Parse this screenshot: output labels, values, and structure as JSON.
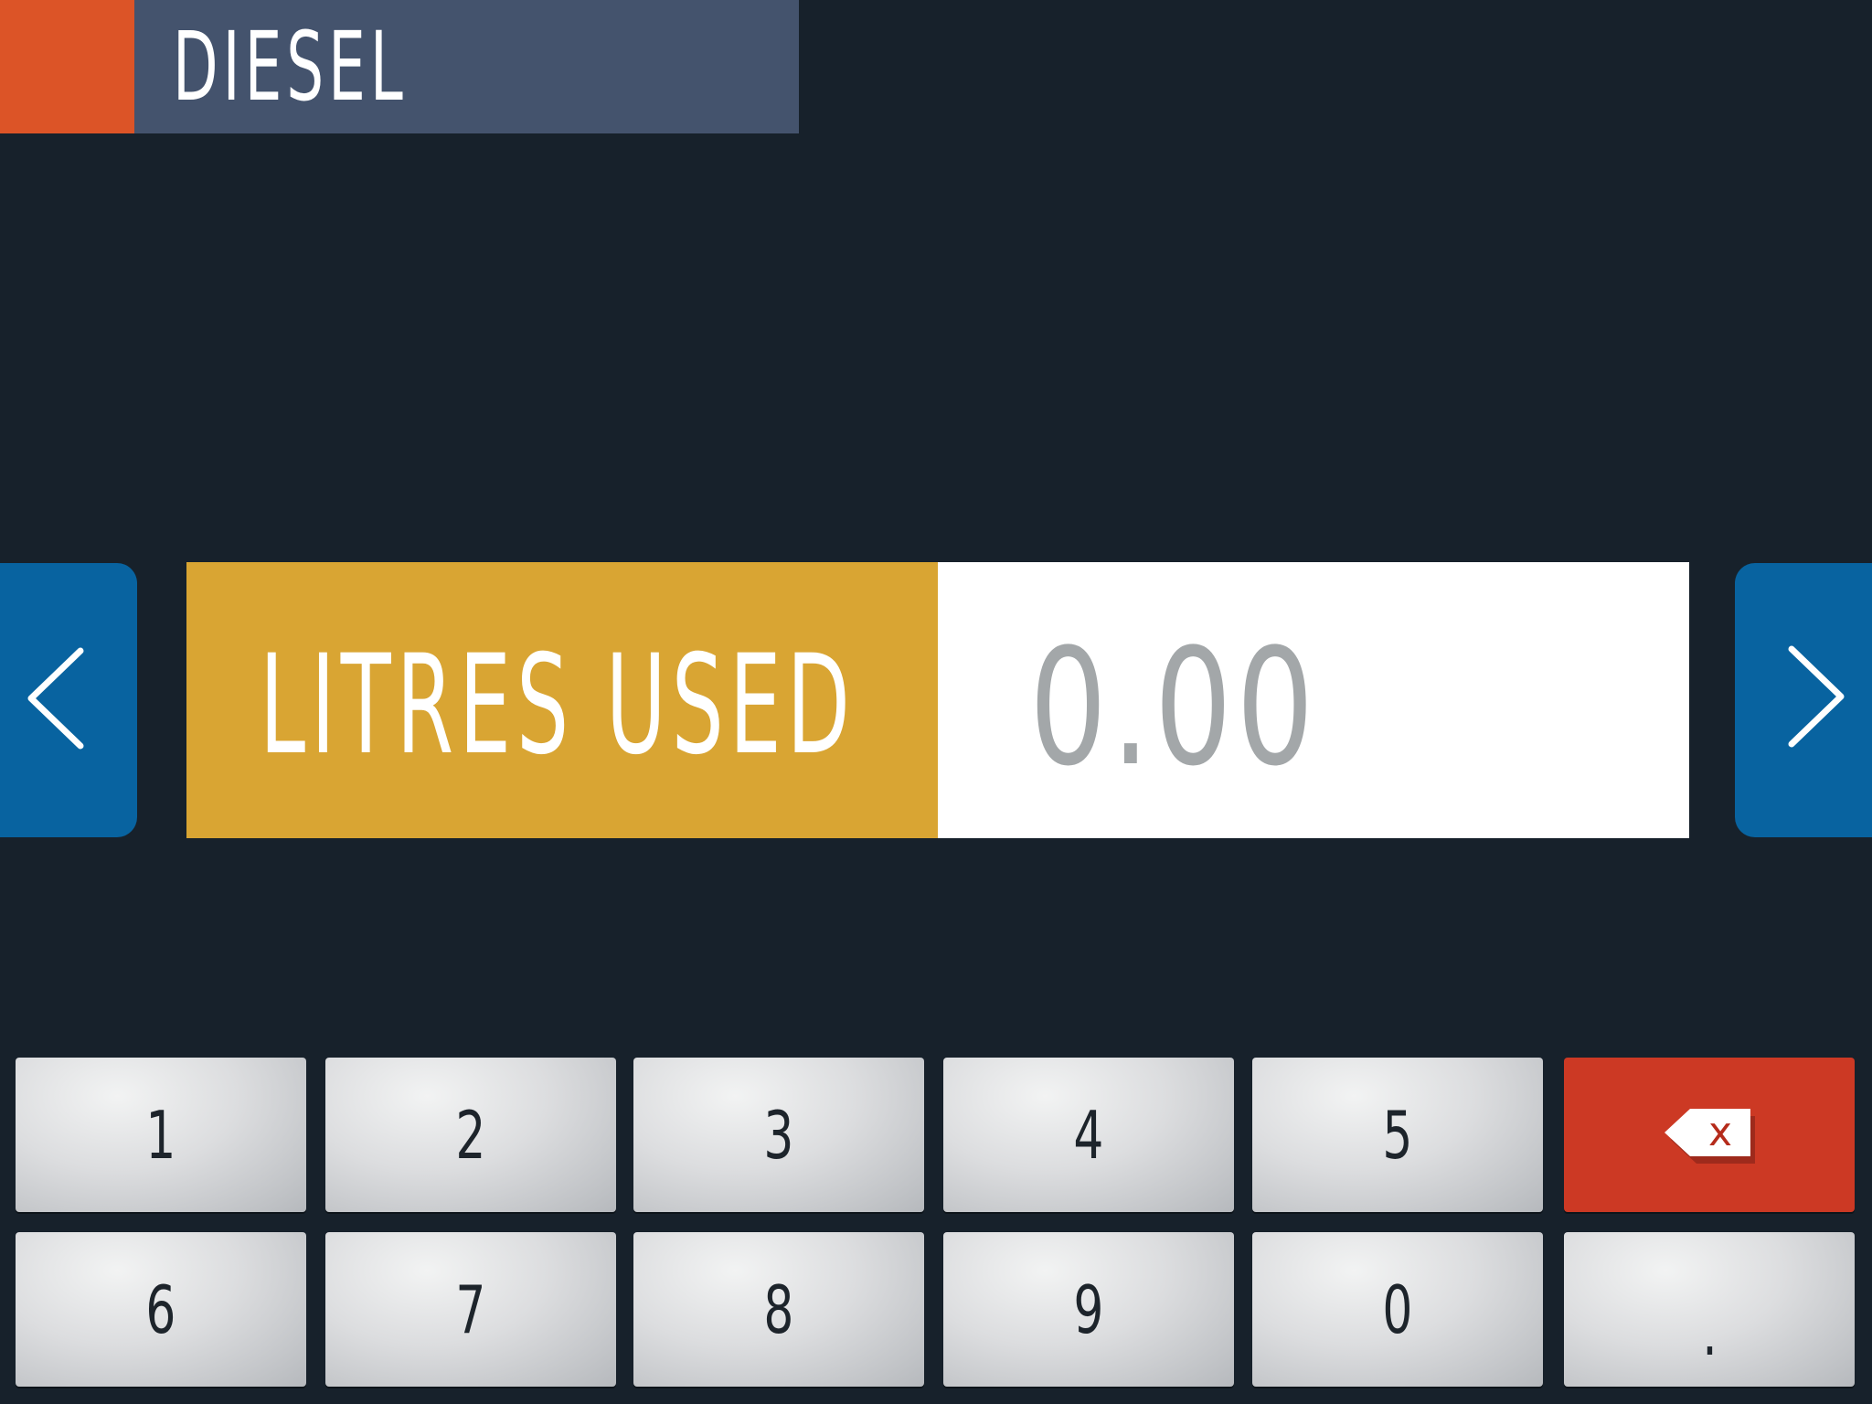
{
  "header": {
    "title": "DIESEL",
    "accent_color": "#dc5427",
    "bar_color": "#44536d"
  },
  "navigation": {
    "prev_icon": "chevron-left-icon",
    "next_icon": "chevron-right-icon",
    "color": "#0863a0"
  },
  "field": {
    "label": "LITRES USED",
    "value": "0.00",
    "label_color": "#d9a533"
  },
  "keypad": {
    "row1": [
      "1",
      "2",
      "3",
      "4",
      "5"
    ],
    "row2": [
      "6",
      "7",
      "8",
      "9",
      "0",
      "."
    ],
    "backspace_icon": "backspace-icon",
    "backspace_glyph": "x",
    "backspace_color": "#cc3924"
  }
}
